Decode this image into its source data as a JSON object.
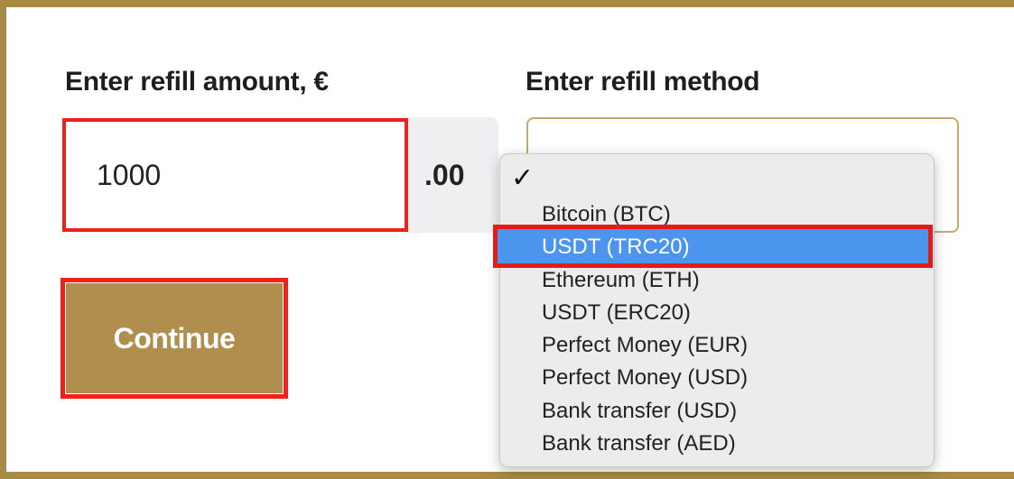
{
  "amount": {
    "label": "Enter refill amount, €",
    "value": "1000",
    "suffix": ".00"
  },
  "method": {
    "label": "Enter refill method",
    "check_mark": "✓",
    "options": [
      "Bitcoin (BTC)",
      "USDT (TRC20)",
      "Ethereum (ETH)",
      "USDT (ERC20)",
      "Perfect Money (EUR)",
      "Perfect Money (USD)",
      "Bank transfer (USD)",
      "Bank transfer (AED)"
    ],
    "highlighted_option": "USDT (TRC20)"
  },
  "actions": {
    "continue_label": "Continue"
  },
  "colors": {
    "frame": "#a88a45",
    "button": "#b08e4e",
    "highlight_outline": "#f0201a",
    "selected_option": "#4b95ee"
  }
}
